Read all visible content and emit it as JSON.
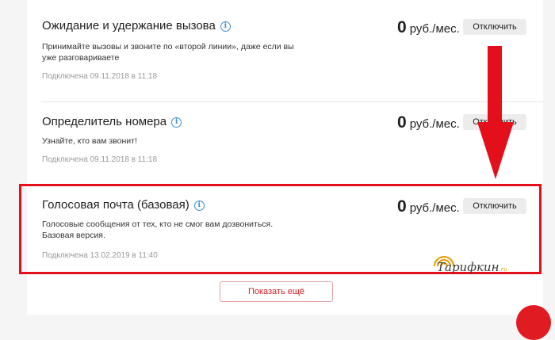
{
  "services": [
    {
      "title": "Ожидание и удержание вызова",
      "description": "Принимайте вызовы и звоните по «второй линии», даже если вы уже разговариваете",
      "date": "Подключена 09.11.2018 в 11:18",
      "price": "0",
      "unit": "руб./мес.",
      "button": "Отключить"
    },
    {
      "title": "Определитель номера",
      "description": "Узнайте, кто вам звонит!",
      "date": "Подключена 09.11.2018 в 11:18",
      "price": "0",
      "unit": "руб./мес.",
      "button": "Отключить"
    },
    {
      "title": "Голосовая почта (базовая)",
      "description": "Голосовые сообщения от тех, кто не смог вам дозвониться. Базовая версия.",
      "date": "Подключена 13.02.2019 в 11:40",
      "price": "0",
      "unit": "руб./мес.",
      "button": "Отключить"
    }
  ],
  "info_icon": "info-circle-icon",
  "show_more": "Показать ещё",
  "watermark": {
    "text": "Тарифкин",
    "suffix": ".ru"
  },
  "colors": {
    "accent_red": "#e3101b",
    "info_blue": "#3a8fd6",
    "watermark_orange": "#e39a00"
  }
}
